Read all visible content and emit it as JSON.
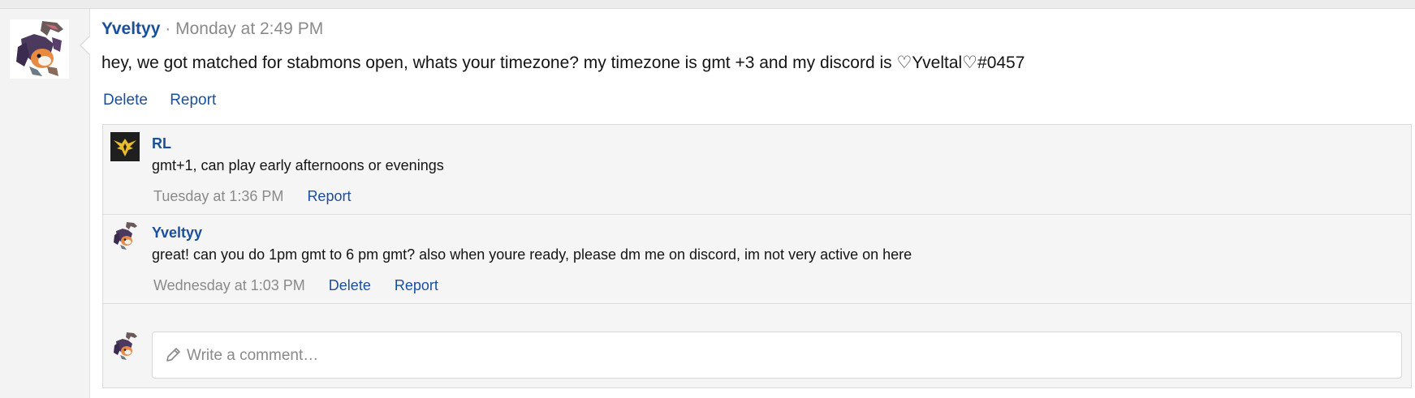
{
  "post": {
    "author": "Yveltyy",
    "separator": "·",
    "timestamp": "Monday at 2:49 PM",
    "message": "hey, we got matched for stabmons open, whats your timezone? my timezone is gmt +3 and my discord is ♡Yveltal♡#0457",
    "actions": {
      "delete": "Delete",
      "report": "Report"
    },
    "avatar_icon": "yveltal-sprite-avatar"
  },
  "comments": [
    {
      "author": "RL",
      "text": "gmt+1, can play early afternoons or evenings",
      "timestamp": "Tuesday at 1:36 PM",
      "actions": {
        "report": "Report"
      },
      "avatar_icon": "team-instinct-avatar"
    },
    {
      "author": "Yveltyy",
      "text": "great! can you do 1pm gmt to 6 pm gmt? also when youre ready, please dm me on discord, im not very active on here",
      "timestamp": "Wednesday at 1:03 PM",
      "actions": {
        "delete": "Delete",
        "report": "Report"
      },
      "avatar_icon": "yveltal-sprite-avatar"
    }
  ],
  "composer": {
    "placeholder": "Write a comment…",
    "icon": "pencil-icon"
  },
  "colors": {
    "link": "#1a4f9c",
    "meta": "#8a8a8a",
    "comment_bg": "#f5f5f5"
  }
}
